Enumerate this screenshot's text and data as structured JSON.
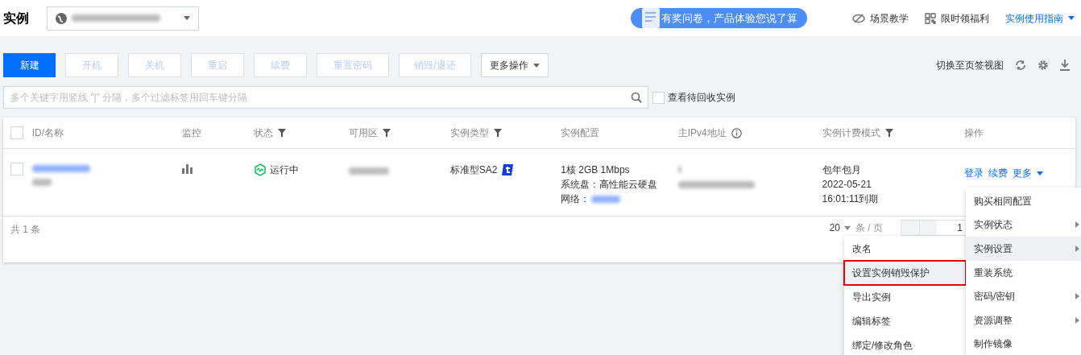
{
  "header": {
    "title": "实例",
    "banner": "有奖问卷，产品体验您说了算",
    "links": [
      {
        "label": "场景教学",
        "kind": "eye"
      },
      {
        "label": "限时领福利",
        "kind": "qr"
      },
      {
        "label": "实例使用指南",
        "kind": "guide"
      }
    ]
  },
  "toolbar": {
    "buttons": [
      {
        "label": "新建",
        "disabled": false,
        "primary": true
      },
      {
        "label": "开机",
        "disabled": true,
        "primary": false
      },
      {
        "label": "关机",
        "disabled": true,
        "primary": false
      },
      {
        "label": "重启",
        "disabled": true,
        "primary": false
      },
      {
        "label": "续费",
        "disabled": true,
        "primary": false
      },
      {
        "label": "重置密码",
        "disabled": true,
        "primary": false
      },
      {
        "label": "销毁/退还",
        "disabled": true,
        "primary": false
      }
    ],
    "more": "更多操作",
    "switch_view": "切换至页签视图"
  },
  "search": {
    "placeholder": "多个关键字用竖线 \"|\" 分隔，多个过滤标签用回车键分隔",
    "recycle": {
      "label": "查看待回收实例",
      "checked": false
    }
  },
  "table": {
    "columns": [
      {
        "label": "ID/名称",
        "kind": "plain"
      },
      {
        "label": "监控",
        "kind": "plain"
      },
      {
        "label": "状态",
        "kind": "filter"
      },
      {
        "label": "可用区",
        "kind": "filter"
      },
      {
        "label": "实例类型",
        "kind": "filter"
      },
      {
        "label": "实例配置",
        "kind": "plain"
      },
      {
        "label": "主IPv4地址",
        "kind": "info"
      },
      {
        "label": "实例计费模式",
        "kind": "filter"
      },
      {
        "label": "操作",
        "kind": "plain"
      }
    ],
    "rows": [
      {
        "checked": false,
        "status": "运行中",
        "type": "标准型SA2",
        "config": [
          "1核 2GB 1Mbps",
          "系统盘：高性能云硬盘",
          "网络："
        ],
        "billing": [
          "包年包月",
          "2022-05-21",
          "16:01:11到期"
        ],
        "actions": [
          "登录",
          "续费",
          "更多"
        ]
      }
    ],
    "select_all_checked": false,
    "total": "共 1 条",
    "page_size": "20",
    "per_page": "条 / 页",
    "page": "1"
  },
  "menu": {
    "items": [
      {
        "label": "购买相同配置",
        "submenu": false,
        "selected": false
      },
      {
        "label": "实例状态",
        "submenu": true,
        "selected": false
      },
      {
        "label": "实例设置",
        "submenu": true,
        "selected": true
      },
      {
        "label": "重装系统",
        "submenu": false,
        "selected": false
      },
      {
        "label": "密码/密钥",
        "submenu": true,
        "selected": false
      },
      {
        "label": "资源调整",
        "submenu": true,
        "selected": false
      },
      {
        "label": "制作镜像",
        "submenu": false,
        "selected": false
      }
    ],
    "submenu": [
      {
        "label": "改名",
        "selected": false
      },
      {
        "label": "设置实例销毁保护",
        "selected": true
      },
      {
        "label": "导出实例",
        "selected": false
      },
      {
        "label": "编辑标签",
        "selected": false
      },
      {
        "label": "绑定/修改角色",
        "selected": false
      }
    ]
  }
}
